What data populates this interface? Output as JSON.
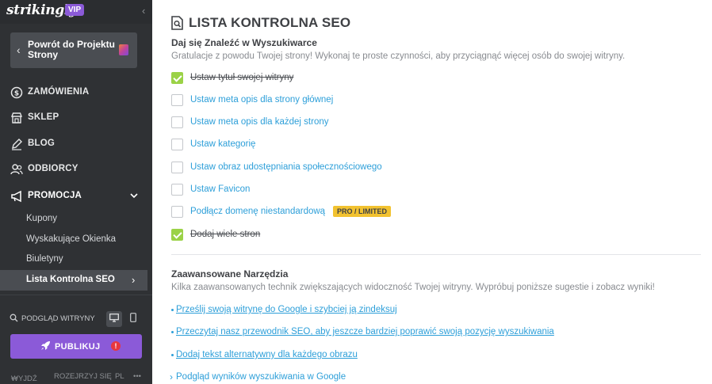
{
  "sidebar": {
    "logo": "strikingly",
    "vip_badge": "VIP",
    "back_button": "Powrót do Projektu Strony",
    "nav": [
      {
        "label": "ZAMÓWIENIA",
        "icon": "dollar-circle-icon"
      },
      {
        "label": "SKLEP",
        "icon": "store-icon"
      },
      {
        "label": "BLOG",
        "icon": "pen-icon"
      },
      {
        "label": "ODBIORCY",
        "icon": "users-icon"
      },
      {
        "label": "PROMOCJA",
        "icon": "megaphone-icon"
      }
    ],
    "submenu": [
      {
        "label": "Kupony"
      },
      {
        "label": "Wyskakujące Okienka"
      },
      {
        "label": "Biuletyny"
      },
      {
        "label": "Lista Kontrolna SEO"
      }
    ],
    "preview_label": "PODGLĄD WITRYNY",
    "publish_label": "PUBLIKUJ",
    "publish_warning": "!",
    "bottom": {
      "exit": "WYJDŹ",
      "explore": "ROZEJRZYJ SIĘ",
      "language": "PL",
      "more": "•••"
    }
  },
  "main": {
    "title": "LISTA KONTROLNA SEO",
    "section1": {
      "heading": "Daj się Znaleźć w Wyszukiwarce",
      "description": "Gratulacje z powodu Twojej strony! Wykonaj te proste czynności, aby przyciągnąć więcej osób do swojej witryny.",
      "items": [
        {
          "label": "Ustaw tytuł swojej witryny",
          "done": true
        },
        {
          "label": "Ustaw meta opis dla strony głównej",
          "done": false
        },
        {
          "label": "Ustaw meta opis dla każdej strony",
          "done": false
        },
        {
          "label": "Ustaw kategorię",
          "done": false
        },
        {
          "label": "Ustaw obraz udostępniania społecznościowego",
          "done": false
        },
        {
          "label": "Ustaw Favicon",
          "done": false
        },
        {
          "label": "Podłącz domenę niestandardową",
          "done": false,
          "badge": "PRO / LIMITED"
        },
        {
          "label": "Dodaj wiele stron",
          "done": true
        }
      ]
    },
    "section2": {
      "heading": "Zaawansowane Narzędzia",
      "description": "Kilka zaawansowanych technik zwiększających widoczność Twojej witryny. Wypróbuj poniższe sugestie i zobacz wyniki!",
      "links": [
        "Prześlij swoją witrynę do Google i szybciej ją zindeksuj",
        "Przeczytaj nasz przewodnik SEO, aby jeszcze bardziej poprawić swoją pozycję wyszukiwania",
        "Dodaj tekst alternatywny dla każdego obrazu"
      ],
      "google_preview": "Podgląd wyników wyszukiwania w Google"
    }
  }
}
